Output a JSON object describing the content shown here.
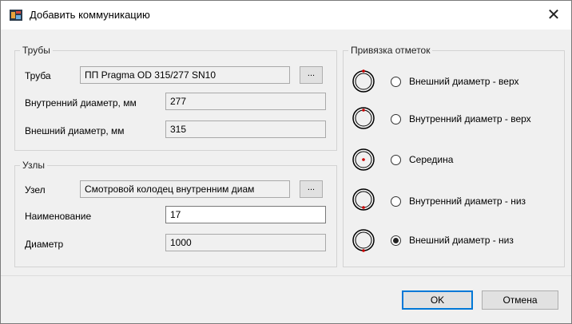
{
  "dialog": {
    "title": "Добавить коммуникацию",
    "close": "✕"
  },
  "pipes": {
    "legend": "Трубы",
    "pipe_label": "Труба",
    "pipe_value": "ПП Pragma OD 315/277 SN10",
    "browse": "...",
    "inner_label": "Внутренний диаметр, мм",
    "inner_value": "277",
    "outer_label": "Внешний диаметр, мм",
    "outer_value": "315"
  },
  "nodes": {
    "legend": "Узлы",
    "node_label": "Узел",
    "node_value": "Смотровой колодец внутренним диам",
    "browse": "...",
    "name_label": "Наименование",
    "name_value": "17",
    "diameter_label": "Диаметр",
    "diameter_value": "1000"
  },
  "binding": {
    "legend": "Привязка отметок",
    "options": [
      {
        "label": "Внешний диаметр - верх",
        "selected": false
      },
      {
        "label": "Внутренний диаметр - верх",
        "selected": false
      },
      {
        "label": "Середина",
        "selected": false
      },
      {
        "label": "Внутренний диаметр - низ",
        "selected": false
      },
      {
        "label": "Внешний диаметр - низ",
        "selected": true
      }
    ]
  },
  "buttons": {
    "ok": "OK",
    "cancel": "Отмена"
  },
  "colors": {
    "accent": "#0078d7",
    "marker": "#cc0000"
  }
}
